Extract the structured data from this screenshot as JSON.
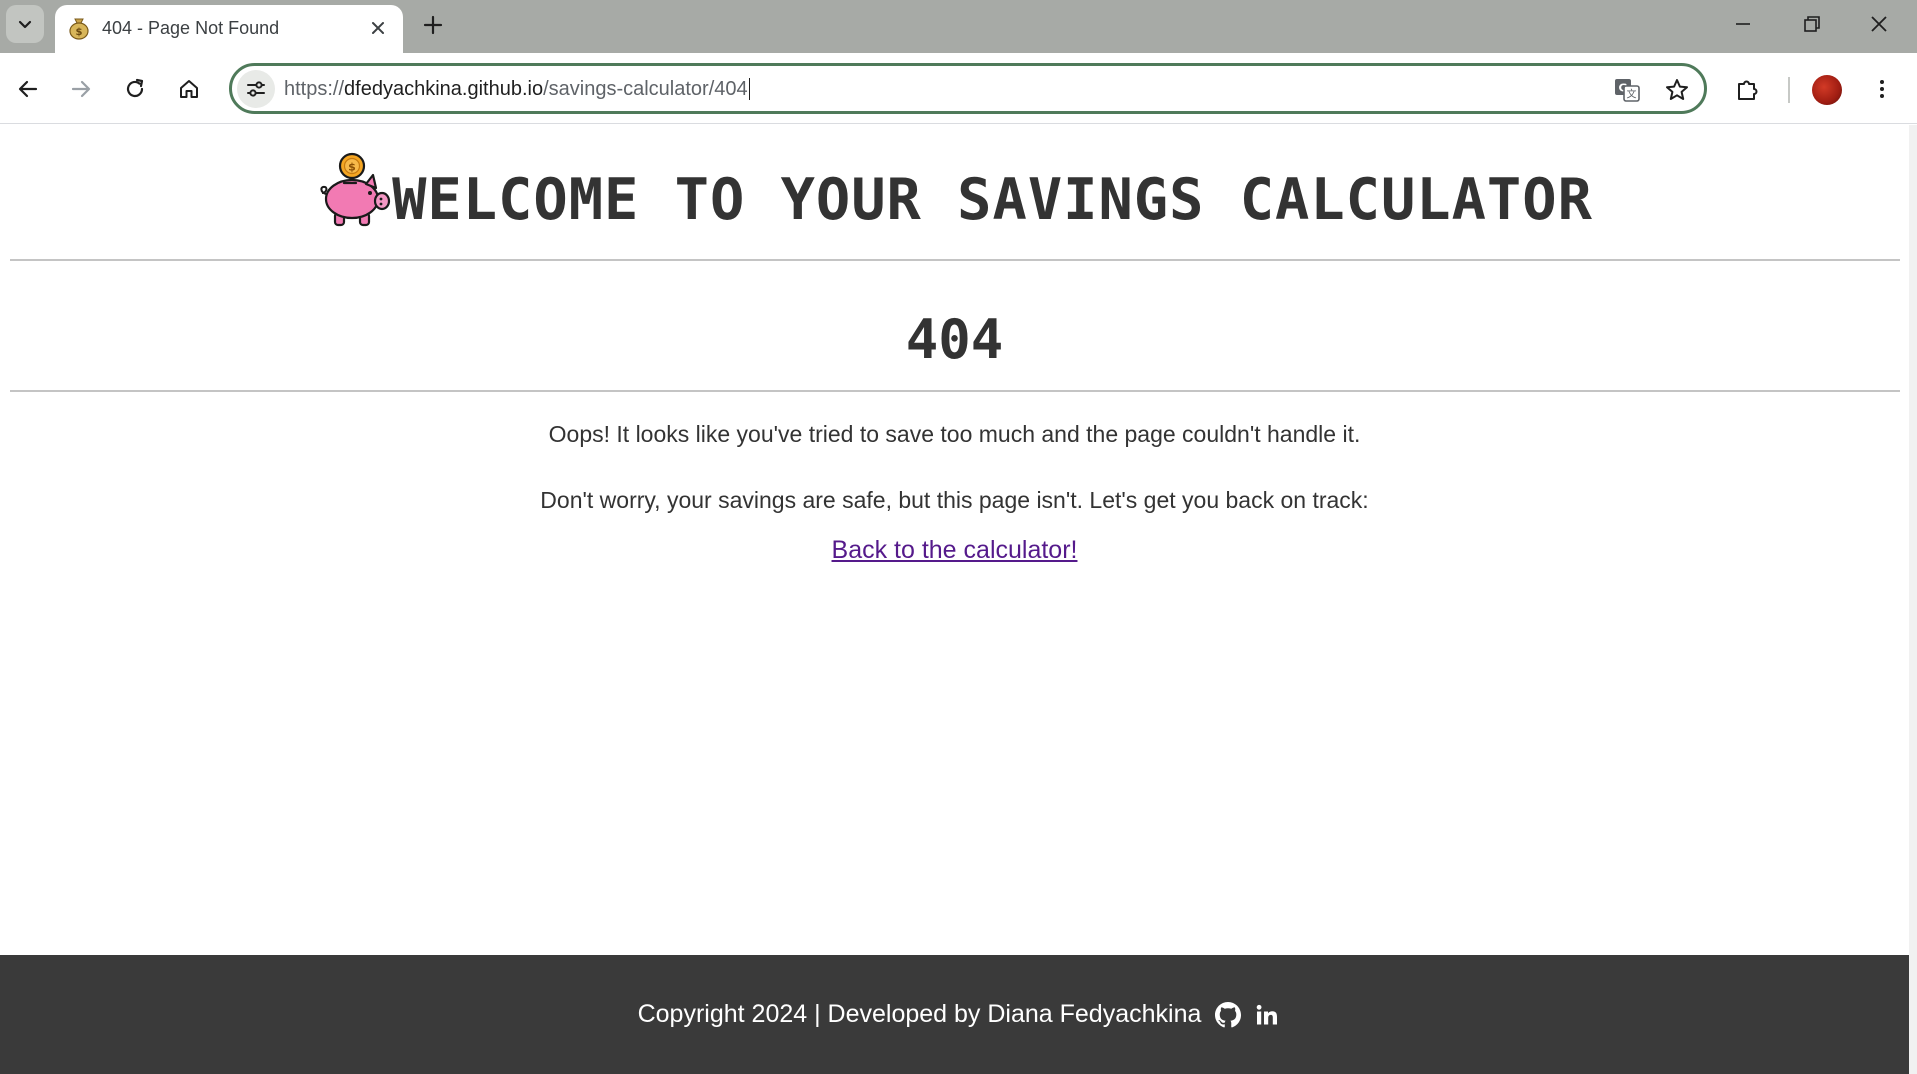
{
  "browser": {
    "tab": {
      "title": "404 - Page Not Found",
      "favicon": "money-bag-icon"
    },
    "url": {
      "scheme": "https://",
      "host": "dfedyachkina.github.io",
      "path": "/savings-calculator/404"
    },
    "accent_color": "#4f7a5a"
  },
  "page": {
    "header": {
      "title": "WELCOME TO YOUR SAVINGS CALCULATOR",
      "logo": "piggy-bank-icon"
    },
    "error": {
      "code": "404",
      "message_1": "Oops! It looks like you've tried to save too much and the page couldn't handle it.",
      "message_2": "Don't worry, your savings are safe, but this page isn't. Let's get you back on track:",
      "link_label": "Back to the calculator!"
    },
    "footer": {
      "text": "Copyright 2024 | Developed by Diana Fedyachkina",
      "icons": [
        "github-icon",
        "linkedin-icon"
      ],
      "background": "#3a3a3a"
    },
    "link_color": "#551a8b"
  }
}
